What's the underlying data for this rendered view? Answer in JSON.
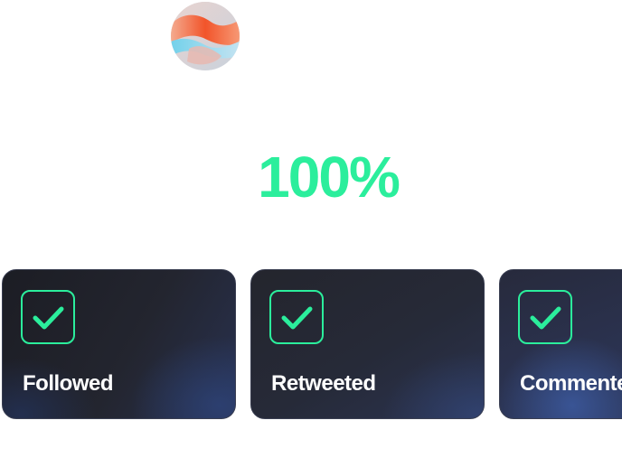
{
  "theme": {
    "accent": "#2bee9c",
    "card_text": "#ffffff",
    "card_bg": "#1f2230"
  },
  "avatar": {
    "icon": "abstract-avatar-image"
  },
  "progress": {
    "percent_label": "100%",
    "value": 100
  },
  "tasks": [
    {
      "label": "Followed",
      "completed": true,
      "icon": "checkmark-icon"
    },
    {
      "label": "Retweeted",
      "completed": true,
      "icon": "checkmark-icon"
    },
    {
      "label": "Commented",
      "completed": true,
      "icon": "checkmark-icon"
    }
  ]
}
